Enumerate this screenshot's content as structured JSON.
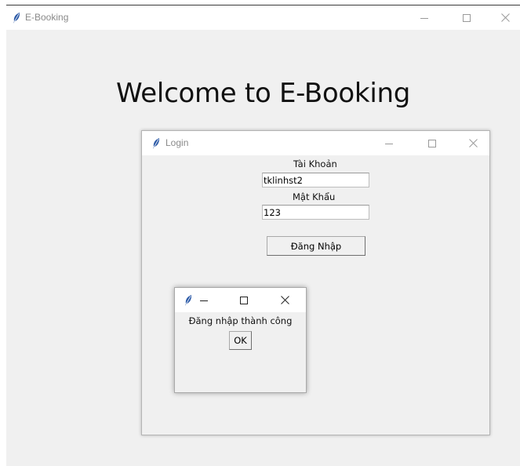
{
  "main_window": {
    "title": "E-Booking",
    "heading": "Welcome to E-Booking"
  },
  "login_window": {
    "title": "Login",
    "username_label": "Tài Khoản",
    "username_value": "tklinhst2",
    "password_label": "Mật Khẩu",
    "password_value": "123",
    "login_button": "Đăng Nhập"
  },
  "message_box": {
    "title": "",
    "message": "Đăng nhập thành công",
    "ok_button": "OK"
  },
  "icons": {
    "app": "feather-icon",
    "minimize": "minimize-icon",
    "maximize": "maximize-icon",
    "close": "close-icon"
  },
  "colors": {
    "window_bg": "#f0f0f0",
    "titlebar_bg": "#ffffff",
    "title_text": "#8a8a8a",
    "feather": "#2d5ba8"
  }
}
